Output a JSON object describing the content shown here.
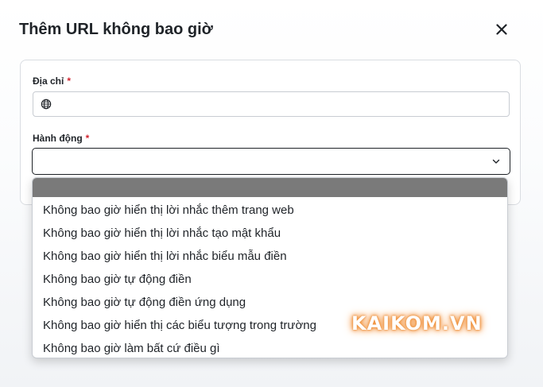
{
  "dialog": {
    "title": "Thêm URL không bao giờ",
    "close_icon": "close-icon"
  },
  "address": {
    "label": "Địa chỉ",
    "required_mark": "*",
    "icon": "globe-icon",
    "value": ""
  },
  "action": {
    "label": "Hành động",
    "required_mark": "*",
    "selected": "",
    "icon": "chevron-down-icon",
    "options": [
      "",
      "Không bao giờ hiển thị lời nhắc thêm trang web",
      "Không bao giờ hiển thị lời nhắc tạo mật khẩu",
      "Không bao giờ hiển thị lời nhắc biểu mẫu điền",
      "Không bao giờ tự động điền",
      "Không bao giờ tự động điền ứng dụng",
      "Không bao giờ hiển thị các biểu tượng trong trường",
      "Không bao giờ làm bất cứ điều gì"
    ]
  },
  "watermark": {
    "text": "KAIKOM.VN"
  },
  "colors": {
    "required": "#d1242f",
    "text": "#1f2328",
    "highlight_option": "#7a7a7a"
  }
}
